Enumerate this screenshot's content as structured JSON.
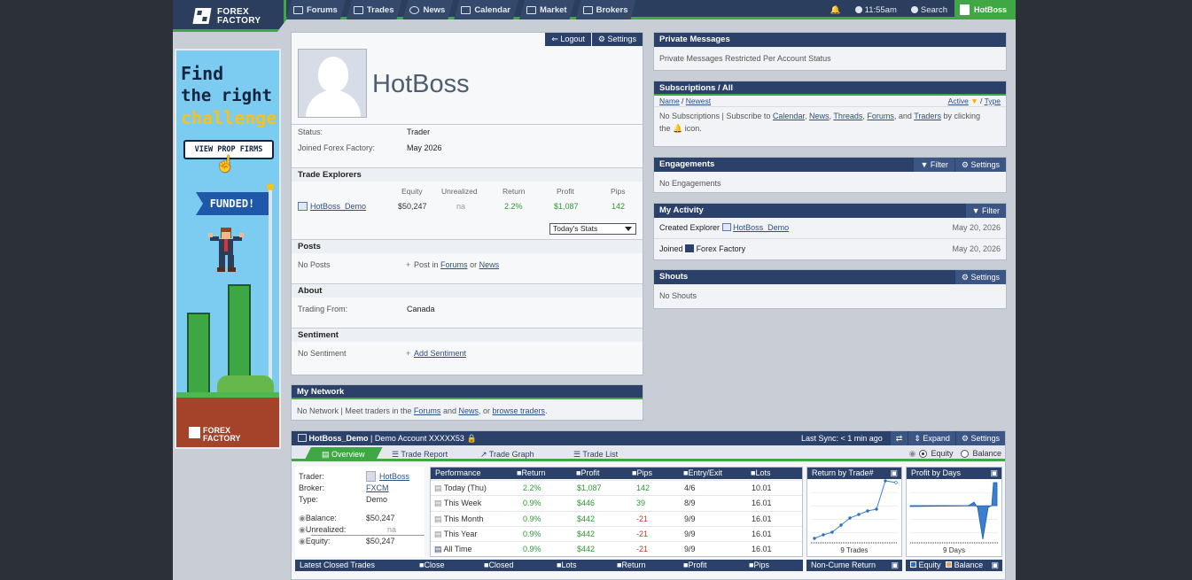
{
  "nav": {
    "logo": [
      "FOREX",
      "FACTORY"
    ],
    "items": [
      "Forums",
      "Trades",
      "News",
      "Calendar",
      "Market",
      "Brokers"
    ],
    "time": "11:55am",
    "search": "Search",
    "user": "HotBoss"
  },
  "ad": {
    "line1": "Find",
    "line2": "the right",
    "line3": "challenge",
    "button": "VIEW PROP FIRMS",
    "flag": "FUNDED!",
    "logo": [
      "FOREX",
      "FACTORY"
    ]
  },
  "profile": {
    "logout": "Logout",
    "settings": "Settings",
    "username": "HotBoss",
    "status_label": "Status:",
    "status": "Trader",
    "joined_label": "Joined Forex Factory:",
    "joined": "May 2026",
    "trade_explorers": "Trade Explorers",
    "te_headers": [
      "Equity",
      "Unrealized",
      "Return",
      "Profit",
      "Pips"
    ],
    "te_row": {
      "name": "HotBoss_Demo",
      "equity": "$50,247",
      "unrealized": "na",
      "return": "2.2%",
      "profit": "$1,087",
      "pips": "142"
    },
    "stats_select": "Today's Stats",
    "posts": "Posts",
    "no_posts": "No Posts",
    "post_in": "Post in",
    "forums": "Forums",
    "or": "or",
    "news": "News",
    "about": "About",
    "trading_from_label": "Trading From:",
    "trading_from": "Canada",
    "sentiment": "Sentiment",
    "no_sentiment": "No Sentiment",
    "add_sentiment": "Add Sentiment"
  },
  "network": {
    "title": "My Network",
    "text1": "No Network | Meet traders in the",
    "forums": "Forums",
    "and": "and",
    "news": "News",
    "or": ", or",
    "browse": "browse traders",
    "end": "."
  },
  "private_messages": {
    "title": "Private Messages",
    "text": "Private Messages Restricted Per Account Status"
  },
  "subscriptions": {
    "title": "Subscriptions / All",
    "name": "Name",
    "newest": "Newest",
    "active": "Active",
    "type": "Type",
    "text1": "No Subscriptions | Subscribe to",
    "links": [
      "Calendar",
      "News",
      "Threads",
      "Forums"
    ],
    "and": ", and",
    "traders": "Traders",
    "text2": "by clicking",
    "text3": "the",
    "text4": "icon."
  },
  "engagements": {
    "title": "Engagements",
    "filter": "Filter",
    "settings": "Settings",
    "text": "No Engagements"
  },
  "activity": {
    "title": "My Activity",
    "filter": "Filter",
    "row1": {
      "text": "Created Explorer",
      "link": "HotBoss_Demo",
      "date": "May 20, 2026"
    },
    "row2": {
      "text": "Joined",
      "tail": "Forex Factory",
      "date": "May 20, 2026"
    }
  },
  "shouts": {
    "title": "Shouts",
    "settings": "Settings",
    "text": "No Shouts"
  },
  "explorer": {
    "name": "HotBoss_Demo",
    "account": "| Demo Account XXXXX53",
    "last_sync": "Last Sync: < 1 min ago",
    "expand": "Expand",
    "settings": "Settings",
    "tabs": [
      "Overview",
      "Trade Report",
      "Trade Graph",
      "Trade List"
    ],
    "equity": "Equity",
    "balance": "Balance",
    "info": {
      "trader_label": "Trader:",
      "trader": "HotBoss",
      "broker_label": "Broker:",
      "broker": "FXCM",
      "type_label": "Type:",
      "type": "Demo",
      "balance_label": "Balance:",
      "balance": "$50,247",
      "unrealized_label": "Unrealized:",
      "unrealized": "na",
      "equity_label": "Equity:",
      "equity": "$50,247"
    },
    "perf_headers": [
      "Performance",
      "Return",
      "Profit",
      "Pips",
      "Entry/Exit",
      "Lots"
    ],
    "perf_rows": [
      {
        "label": "Today (Thu)",
        "return": "2.2%",
        "profit": "$1,087",
        "pips": "142",
        "entry": "4/6",
        "lots": "10.01"
      },
      {
        "label": "This Week",
        "return": "0.9%",
        "profit": "$446",
        "pips": "39",
        "entry": "8/9",
        "lots": "16.01"
      },
      {
        "label": "This Month",
        "return": "0.9%",
        "profit": "$442",
        "pips": "-21",
        "entry": "9/9",
        "lots": "16.01"
      },
      {
        "label": "This Year",
        "return": "0.9%",
        "profit": "$442",
        "pips": "-21",
        "entry": "9/9",
        "lots": "16.01"
      },
      {
        "label": "All Time",
        "return": "0.9%",
        "profit": "$442",
        "pips": "-21",
        "entry": "9/9",
        "lots": "16.01"
      }
    ],
    "return_chart": {
      "title": "Return by Trade#",
      "footer": "9 Trades"
    },
    "profit_chart": {
      "title": "Profit by Days",
      "footer": "9 Days"
    },
    "bottom_headers": [
      "Latest Closed Trades",
      "Close",
      "Closed",
      "Lots",
      "Return",
      "Profit",
      "Pips"
    ],
    "non_cume": "Non-Cume Return",
    "bottom_equity": "Equity",
    "bottom_balance": "Balance"
  },
  "colors": {
    "navy": "#2c4169",
    "green": "#3fa845",
    "positive": "#2e9a36",
    "negative": "#c0392b"
  }
}
